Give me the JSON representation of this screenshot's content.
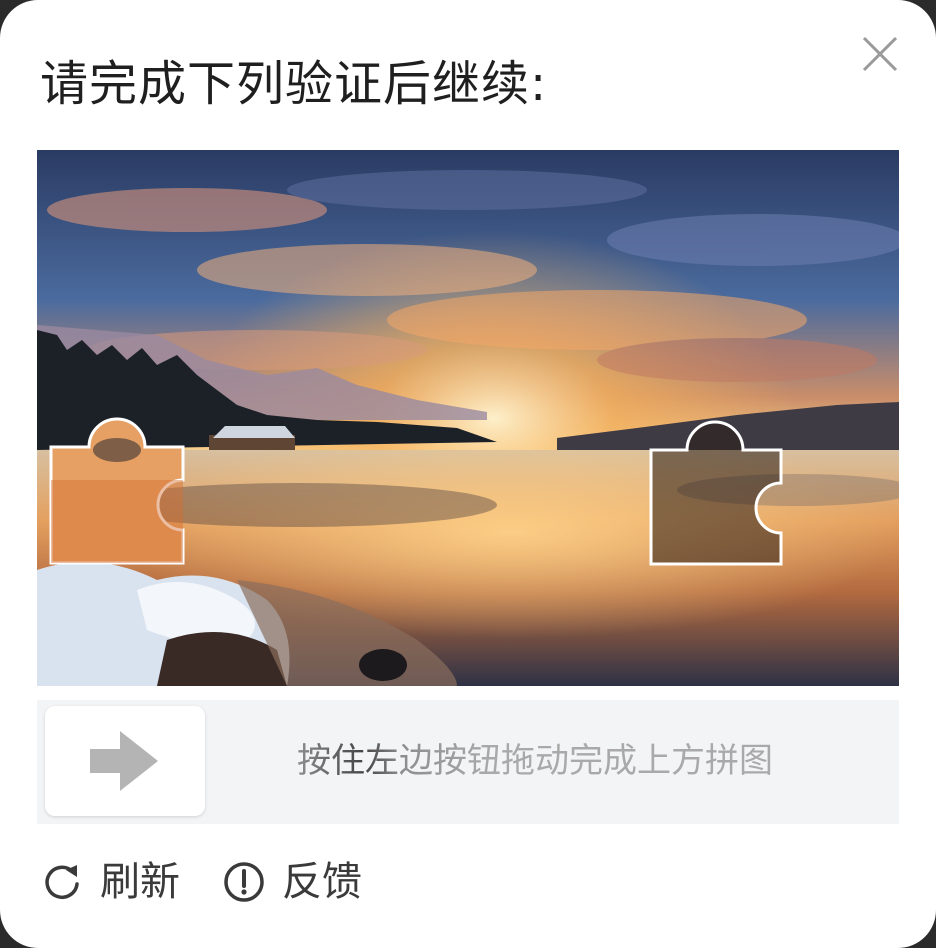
{
  "dialog": {
    "title": "请完成下列验证后继续:",
    "close_icon": "close-icon"
  },
  "puzzle": {
    "image": "lake-sunset-mountains",
    "piece_icon": "puzzle-piece",
    "target_icon": "puzzle-slot"
  },
  "slider": {
    "hint": "按住左边按钮拖动完成上方拼图",
    "knob_icon": "arrow-right-icon"
  },
  "footer": {
    "refresh_label": "刷新",
    "refresh_icon": "refresh-icon",
    "feedback_label": "反馈",
    "feedback_icon": "info-circle-icon"
  },
  "colors": {
    "track_bg": "#f3f4f6",
    "icon_gray": "#b4b4b4",
    "text_dark": "#1f1f1f"
  }
}
